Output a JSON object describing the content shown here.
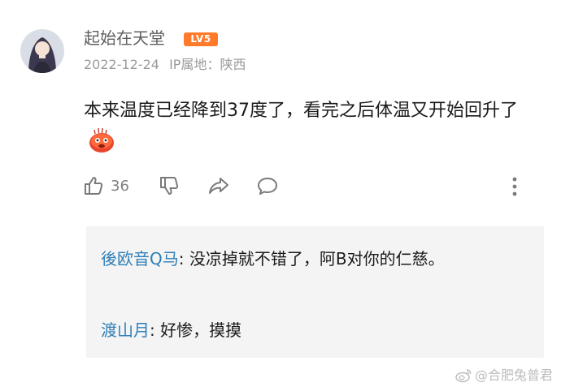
{
  "comment": {
    "username": "起始在天堂",
    "level_badge": "LV5",
    "date": "2022-12-24",
    "ip_location": "IP属地：陕西",
    "text": "本来温度已经降到37度了，看完之后体温又开始回升了",
    "emoji_icon": "hot-face-emoji"
  },
  "actions": {
    "like_count": "36"
  },
  "replies": [
    {
      "user": "後欧音Q马",
      "separator": ": ",
      "text": "没凉掉就不错了，阿B对你的仁慈。"
    },
    {
      "user": "渡山月",
      "separator": ": ",
      "text": "好惨，摸摸"
    }
  ],
  "watermark": {
    "text": "@合肥兔普君",
    "icon": "weibo-icon"
  },
  "colors": {
    "badge": "#ff7a2a",
    "reply_user": "#2f7fb8",
    "reply_bg": "#f4f4f4"
  }
}
